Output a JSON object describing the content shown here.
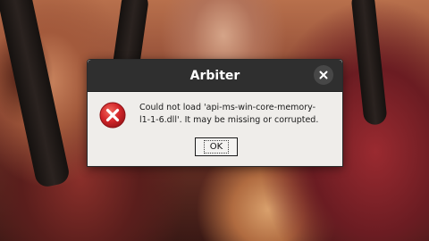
{
  "dialog": {
    "title": "Arbiter",
    "message": "Could not load 'api-ms-win-core-memory-\nl1-1-6.dll'. It may be missing or corrupted.",
    "ok_label": "OK",
    "icon": "error-icon",
    "close_icon": "close-icon"
  },
  "colors": {
    "titlebar": "#2f2f2f",
    "dialog_bg": "#efedea",
    "error_red": "#d3262a"
  }
}
